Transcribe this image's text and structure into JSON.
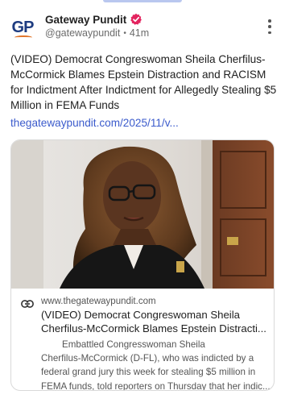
{
  "post": {
    "author": {
      "display_name": "Gateway Pundit",
      "handle": "@gatewaypundit",
      "separator": "•",
      "time_ago": "41m",
      "avatar_initials": "GP",
      "avatar_icon": "gateway-pundit-logo",
      "verified_icon": "verified-badge-icon"
    },
    "text": "(VIDEO) Democrat Congreswoman Sheila Cherfilus-McCormick Blames Epstein Distraction and RACISM for Indictment After Indictment for Allegedly Stealing $5 Million in FEMA Funds",
    "link_text": "thegatewaypundit.com/2025/11/v...",
    "more_icon": "kebab-menu-icon"
  },
  "card": {
    "domain": "www.thegatewaypundit.com",
    "title_line1": "(VIDEO) Democrat Congreswoman Sheila",
    "title_line2": "Cherfilus-McCormick Blames Epstein Distracti...",
    "desc_line1": "Embattled Congresswoman Sheila",
    "desc_line2": "Cherfilus-McCormick (D-FL), who was indicted by a",
    "desc_line3": "federal grand jury this week for stealing $5 million in",
    "desc_line4": "FEMA funds, told reporters on Thursday that her indic...",
    "link_icon": "link-icon",
    "image_alt": "woman-with-glasses-photo"
  },
  "colors": {
    "accent_blue": "#3b5bcc",
    "verified_pink": "#e3245f",
    "logo_blue": "#1d3b80",
    "logo_orange": "#e0742a"
  }
}
